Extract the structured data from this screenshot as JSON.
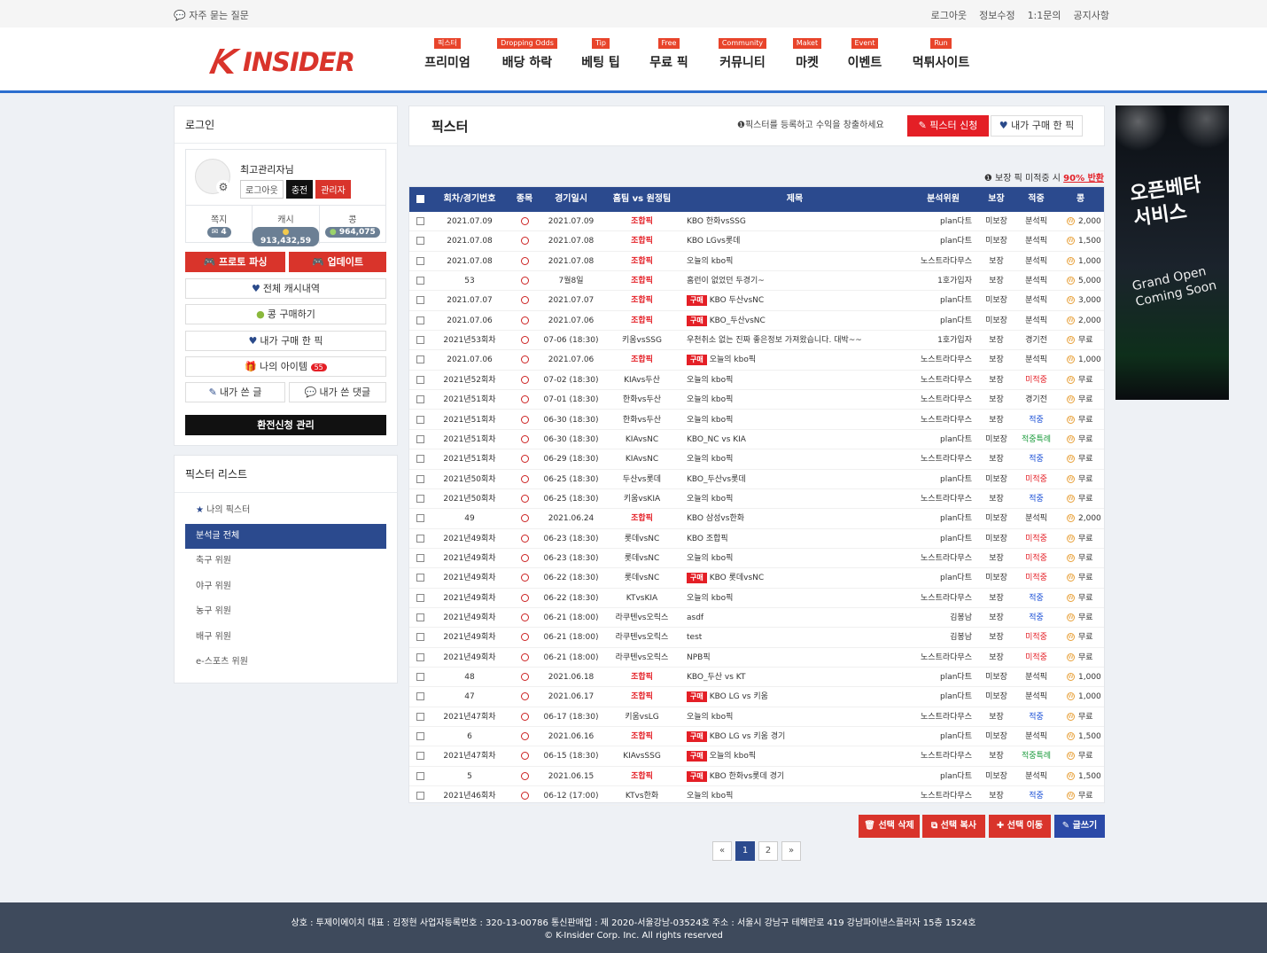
{
  "topbar": {
    "faq": "자주 묻는 질문",
    "links": [
      "로그아웃",
      "정보수정",
      "1:1문의",
      "공지사항"
    ]
  },
  "nav": [
    {
      "tag": "픽스터",
      "label": "프리미엄"
    },
    {
      "tag": "Dropping Odds",
      "label": "배당 하락"
    },
    {
      "tag": "Tip",
      "label": "베팅 팁"
    },
    {
      "tag": "Free",
      "label": "무료 픽"
    },
    {
      "tag": "Community",
      "label": "커뮤니티"
    },
    {
      "tag": "Maket",
      "label": "마켓"
    },
    {
      "tag": "Event",
      "label": "이벤트"
    },
    {
      "tag": "Run",
      "label": "먹튀사이트"
    }
  ],
  "logo": {
    "text": "INSIDER",
    "color": "#d9342b"
  },
  "login": {
    "title": "로그인",
    "username": "최고관리자님",
    "btn_logout": "로그아웃",
    "btn_charge": "충전",
    "btn_admin": "관리자",
    "stats": [
      {
        "label": "쪽지",
        "value": "4"
      },
      {
        "label": "캐시",
        "value": "913,432,59"
      },
      {
        "label": "콩",
        "value": "964,075"
      }
    ],
    "btn_proto": "프로토 파싱",
    "btn_update": "업데이트",
    "menu": [
      "전체 캐시내역",
      "콩 구매하기",
      "내가 구매 한 픽",
      "나의 아이템",
      "내가 쓴 글",
      "내가 쓴 댓글"
    ],
    "item_badge": "55",
    "refund_manage": "환전신청 관리"
  },
  "pixster_list": {
    "title": "픽스터 리스트",
    "items": [
      "나의 픽스터",
      "분석글 전체",
      "축구 위원",
      "야구 위원",
      "농구 위원",
      "배구 위원",
      "e-스포츠 위원"
    ]
  },
  "main": {
    "title": "픽스터",
    "hint": "픽스터를 등록하고 수익을 창출하세요",
    "apply_btn": "픽스터 신청",
    "bought_btn": "내가 구매 한 픽",
    "refund_note": "보장 픽 미적중 시",
    "refund_rate": "90% 반환"
  },
  "table": {
    "headers": [
      "회차/경기번호",
      "종목",
      "경기일시",
      "홈팀 vs 원정팀",
      "제목",
      "분석위원",
      "보장",
      "적중",
      "콩"
    ],
    "rows": [
      [
        "2021.07.09",
        "2021.07.09",
        "조합픽",
        "",
        "KBO 한화vsSSG",
        "plan다트",
        "미보장",
        "분석픽",
        "2,000"
      ],
      [
        "2021.07.08",
        "2021.07.08",
        "조합픽",
        "",
        "KBO LGvs롯데",
        "plan다트",
        "미보장",
        "분석픽",
        "1,500"
      ],
      [
        "2021.07.08",
        "2021.07.08",
        "조합픽",
        "",
        "오늘의 kbo픽",
        "노스트라다무스",
        "보장",
        "분석픽",
        "1,000"
      ],
      [
        "53",
        "7월8일",
        "조합픽",
        "",
        "홈런이 없었던 두경기~",
        "1호가입자",
        "보장",
        "분석픽",
        "5,000"
      ],
      [
        "2021.07.07",
        "2021.07.07",
        "조합픽",
        "구매",
        "KBO 두산vsNC",
        "plan다트",
        "미보장",
        "분석픽",
        "3,000"
      ],
      [
        "2021.07.06",
        "2021.07.06",
        "조합픽",
        "구매",
        "KBO_두산vsNC",
        "plan다트",
        "미보장",
        "분석픽",
        "2,000"
      ],
      [
        "2021년53회차",
        "07-06 (18:30)",
        "키움vsSSG",
        "",
        "우천취소 없는 진짜 좋은정보 가져왔습니다. 대박~~",
        "1호가입자",
        "보장",
        "경기전",
        "무료"
      ],
      [
        "2021.07.06",
        "2021.07.06",
        "조합픽",
        "구매",
        "오늘의 kbo픽",
        "노스트라다무스",
        "보장",
        "분석픽",
        "1,000"
      ],
      [
        "2021년52회차",
        "07-02 (18:30)",
        "KIAvs두산",
        "",
        "오늘의 kbo픽",
        "노스트라다무스",
        "보장",
        "미적중",
        "무료"
      ],
      [
        "2021년51회차",
        "07-01 (18:30)",
        "한화vs두산",
        "",
        "오늘의 kbo픽",
        "노스트라다무스",
        "보장",
        "경기전",
        "무료"
      ],
      [
        "2021년51회차",
        "06-30 (18:30)",
        "한화vs두산",
        "",
        "오늘의 kbo픽",
        "노스트라다무스",
        "보장",
        "적중",
        "무료"
      ],
      [
        "2021년51회차",
        "06-30 (18:30)",
        "KIAvsNC",
        "",
        "KBO_NC vs KIA",
        "plan다트",
        "미보장",
        "적중특례",
        "무료"
      ],
      [
        "2021년51회차",
        "06-29 (18:30)",
        "KIAvsNC",
        "",
        "오늘의 kbo픽",
        "노스트라다무스",
        "보장",
        "적중",
        "무료"
      ],
      [
        "2021년50회차",
        "06-25 (18:30)",
        "두산vs롯데",
        "",
        "KBO_두산vs롯데",
        "plan다트",
        "미보장",
        "미적중",
        "무료"
      ],
      [
        "2021년50회차",
        "06-25 (18:30)",
        "키움vsKIA",
        "",
        "오늘의 kbo픽",
        "노스트라다무스",
        "보장",
        "적중",
        "무료"
      ],
      [
        "49",
        "2021.06.24",
        "조합픽",
        "",
        "KBO 삼성vs한화",
        "plan다트",
        "미보장",
        "분석픽",
        "2,000"
      ],
      [
        "2021년49회차",
        "06-23 (18:30)",
        "롯데vsNC",
        "",
        "KBO 조합픽",
        "plan다트",
        "미보장",
        "미적중",
        "무료"
      ],
      [
        "2021년49회차",
        "06-23 (18:30)",
        "롯데vsNC",
        "",
        "오늘의 kbo픽",
        "노스트라다무스",
        "보장",
        "미적중",
        "무료"
      ],
      [
        "2021년49회차",
        "06-22 (18:30)",
        "롯데vsNC",
        "구매",
        "KBO 롯데vsNC",
        "plan다트",
        "미보장",
        "미적중",
        "무료"
      ],
      [
        "2021년49회차",
        "06-22 (18:30)",
        "KTvsKIA",
        "",
        "오늘의 kbo픽",
        "노스트라다무스",
        "보장",
        "적중",
        "무료"
      ],
      [
        "2021년49회차",
        "06-21 (18:00)",
        "라쿠텐vs오릭스",
        "",
        "asdf",
        "김봉남",
        "보장",
        "적중",
        "무료"
      ],
      [
        "2021년49회차",
        "06-21 (18:00)",
        "라쿠텐vs오릭스",
        "",
        "test",
        "김봉남",
        "보장",
        "미적중",
        "무료"
      ],
      [
        "2021년49회차",
        "06-21 (18:00)",
        "라쿠텐vs오릭스",
        "",
        "NPB픽",
        "노스트라다무스",
        "보장",
        "미적중",
        "무료"
      ],
      [
        "48",
        "2021.06.18",
        "조합픽",
        "",
        "KBO_두산 vs KT",
        "plan다트",
        "미보장",
        "분석픽",
        "1,000"
      ],
      [
        "47",
        "2021.06.17",
        "조합픽",
        "구매",
        "KBO LG vs 키움",
        "plan다트",
        "미보장",
        "분석픽",
        "1,000"
      ],
      [
        "2021년47회차",
        "06-17 (18:30)",
        "키움vsLG",
        "",
        "오늘의 kbo픽",
        "노스트라다무스",
        "보장",
        "적중",
        "무료"
      ],
      [
        "6",
        "2021.06.16",
        "조합픽",
        "구매",
        "KBO LG vs 키움 경기",
        "plan다트",
        "미보장",
        "분석픽",
        "1,500"
      ],
      [
        "2021년47회차",
        "06-15 (18:30)",
        "KIAvsSSG",
        "구매",
        "오늘의 kbo픽",
        "노스트라다무스",
        "보장",
        "적중특례",
        "무료"
      ],
      [
        "5",
        "2021.06.15",
        "조합픽",
        "구매",
        "KBO 한화vs롯데 경기",
        "plan다트",
        "미보장",
        "분석픽",
        "1,500"
      ],
      [
        "2021년46회차",
        "06-12 (17:00)",
        "KTvs한화",
        "",
        "오늘의 kbo픽",
        "노스트라다무스",
        "보장",
        "적중",
        "무료"
      ]
    ]
  },
  "actions": [
    "선택 삭제",
    "선택 복사",
    "선택 이동",
    "글쓰기"
  ],
  "pagination": [
    "«",
    "1",
    "2",
    "»"
  ],
  "ad": {
    "title": "오픈베타 서비스",
    "subtitle": "Grand Open Coming Soon"
  },
  "footer": {
    "line1": "상호 : 투제이에이치 대표 : 김정현 사업자등록번호 : 320-13-00786 통신판매업 : 제 2020-서울강남-03524호 주소 : 서울시 강남구 테헤란로 419 강남파이낸스플라자 15층 1524호",
    "line2": "© K-Insider Corp. Inc. All rights reserved"
  }
}
